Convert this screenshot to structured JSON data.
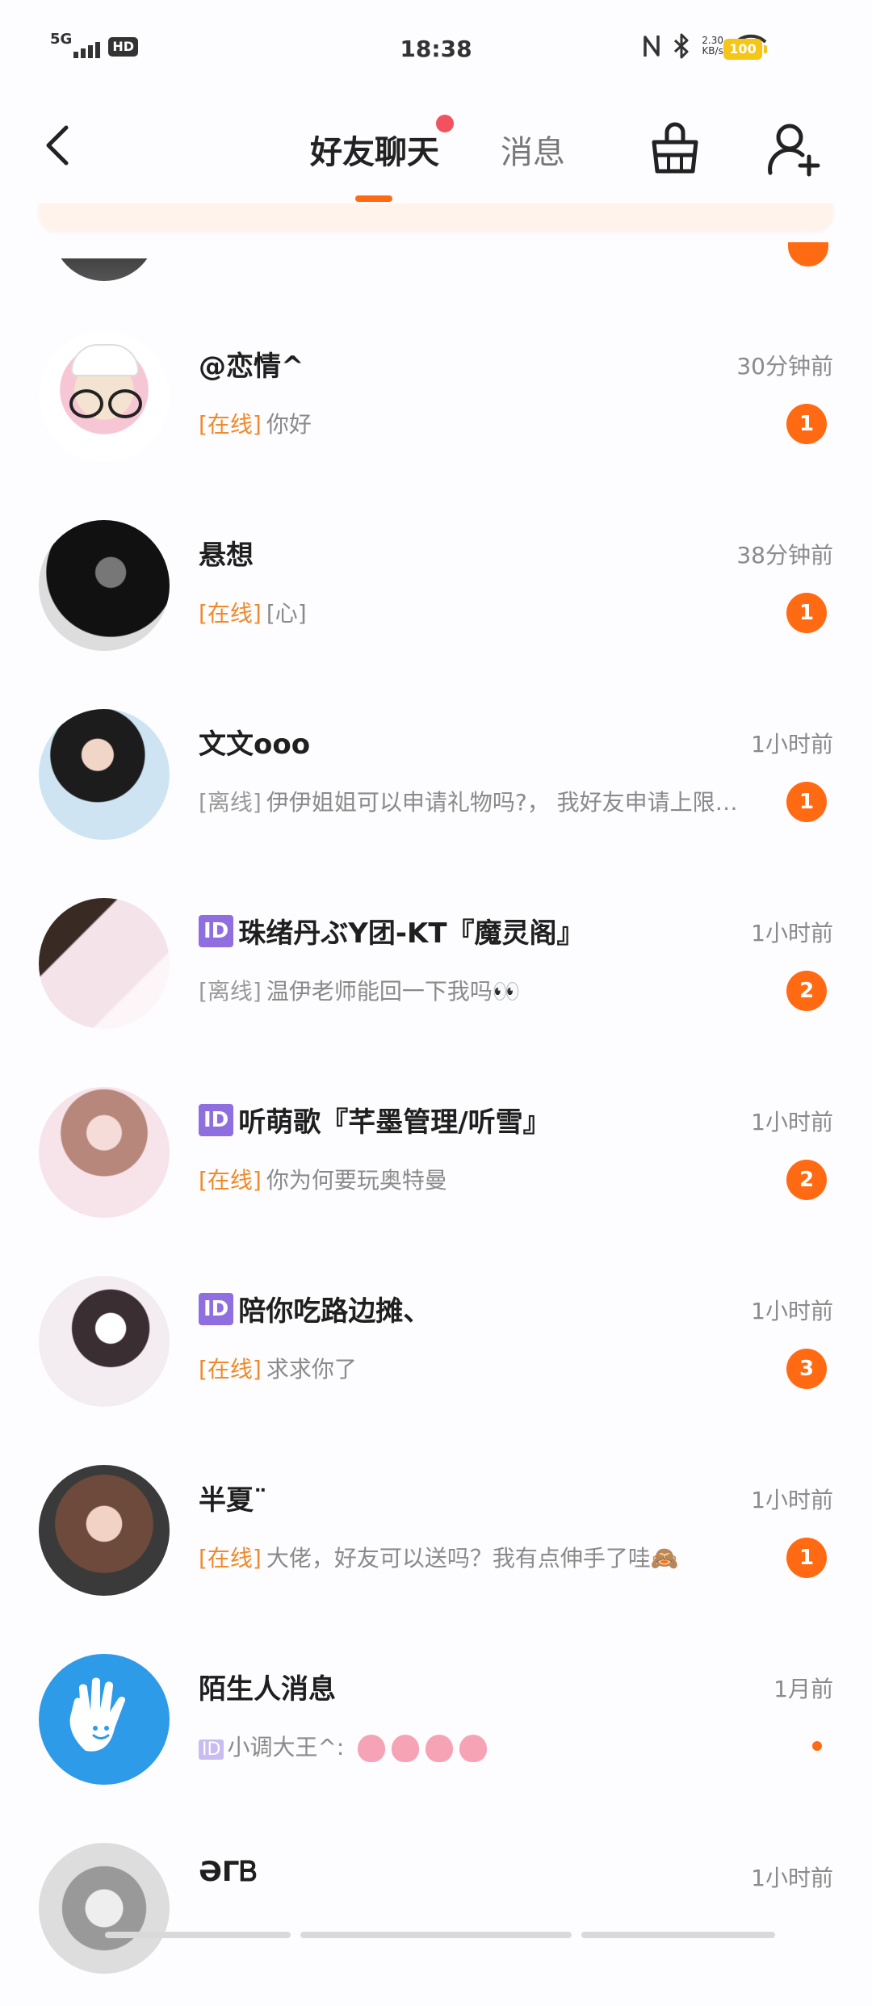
{
  "status_bar": {
    "network": "5G",
    "hd": "HD",
    "time": "18:38",
    "speed_value": "2.30",
    "speed_unit": "KB/s",
    "battery": "100"
  },
  "header": {
    "tab_friends": "好友聊天",
    "tab_messages": "消息"
  },
  "colors": {
    "accent": "#ff6a13",
    "online": "#f08a2a",
    "id_badge": "#8f6ee0"
  },
  "conversations": [
    {
      "name": "@恋情^",
      "time": "30分钟前",
      "status": "[在线]",
      "online": true,
      "message": "你好",
      "unread": "1"
    },
    {
      "name": "悬想",
      "time": "38分钟前",
      "status": "[在线]",
      "online": true,
      "message": "[心]",
      "unread": "1"
    },
    {
      "name": "文文ooo",
      "time": "1小时前",
      "status": "[离线]",
      "online": false,
      "message": "伊伊姐姐可以申请礼物吗?， 我好友申请上限…",
      "unread": "1"
    },
    {
      "id_tag": "ID",
      "name": "珠绪丹ぶY团-KT『魔灵阁』",
      "time": "1小时前",
      "status": "[离线]",
      "online": false,
      "message": "温伊老师能回一下我吗👀",
      "unread": "2"
    },
    {
      "id_tag": "ID",
      "name": "听萌歌『芊墨管理/听雪』",
      "time": "1小时前",
      "status": "[在线]",
      "online": true,
      "message": "你为何要玩奥特曼",
      "unread": "2"
    },
    {
      "id_tag": "ID",
      "name": "陪你吃路边摊、",
      "time": "1小时前",
      "status": "[在线]",
      "online": true,
      "message": "求求你了",
      "unread": "3"
    },
    {
      "name": "半夏¨",
      "time": "1小时前",
      "status": "[在线]",
      "online": true,
      "message": "大佬，好友可以送吗？我有点伸手了哇🙈",
      "unread": "1"
    },
    {
      "name": "陌生人消息",
      "time": "1月前",
      "id_tag_small": "ID",
      "message": "小调大王^:",
      "tongue_icon": "tongue-emoji-icon"
    },
    {
      "name": "ƏΓᏴ",
      "time": "1小时前"
    }
  ]
}
